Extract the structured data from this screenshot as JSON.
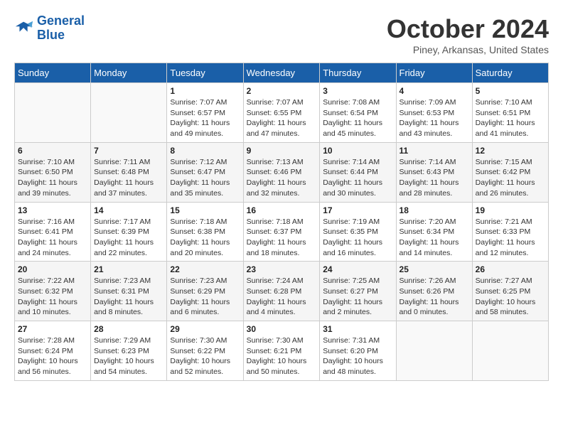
{
  "logo": {
    "line1": "General",
    "line2": "Blue"
  },
  "title": "October 2024",
  "location": "Piney, Arkansas, United States",
  "days_header": [
    "Sunday",
    "Monday",
    "Tuesday",
    "Wednesday",
    "Thursday",
    "Friday",
    "Saturday"
  ],
  "weeks": [
    [
      {
        "date": "",
        "sunrise": "",
        "sunset": "",
        "daylight": ""
      },
      {
        "date": "",
        "sunrise": "",
        "sunset": "",
        "daylight": ""
      },
      {
        "date": "1",
        "sunrise": "Sunrise: 7:07 AM",
        "sunset": "Sunset: 6:57 PM",
        "daylight": "Daylight: 11 hours and 49 minutes."
      },
      {
        "date": "2",
        "sunrise": "Sunrise: 7:07 AM",
        "sunset": "Sunset: 6:55 PM",
        "daylight": "Daylight: 11 hours and 47 minutes."
      },
      {
        "date": "3",
        "sunrise": "Sunrise: 7:08 AM",
        "sunset": "Sunset: 6:54 PM",
        "daylight": "Daylight: 11 hours and 45 minutes."
      },
      {
        "date": "4",
        "sunrise": "Sunrise: 7:09 AM",
        "sunset": "Sunset: 6:53 PM",
        "daylight": "Daylight: 11 hours and 43 minutes."
      },
      {
        "date": "5",
        "sunrise": "Sunrise: 7:10 AM",
        "sunset": "Sunset: 6:51 PM",
        "daylight": "Daylight: 11 hours and 41 minutes."
      }
    ],
    [
      {
        "date": "6",
        "sunrise": "Sunrise: 7:10 AM",
        "sunset": "Sunset: 6:50 PM",
        "daylight": "Daylight: 11 hours and 39 minutes."
      },
      {
        "date": "7",
        "sunrise": "Sunrise: 7:11 AM",
        "sunset": "Sunset: 6:48 PM",
        "daylight": "Daylight: 11 hours and 37 minutes."
      },
      {
        "date": "8",
        "sunrise": "Sunrise: 7:12 AM",
        "sunset": "Sunset: 6:47 PM",
        "daylight": "Daylight: 11 hours and 35 minutes."
      },
      {
        "date": "9",
        "sunrise": "Sunrise: 7:13 AM",
        "sunset": "Sunset: 6:46 PM",
        "daylight": "Daylight: 11 hours and 32 minutes."
      },
      {
        "date": "10",
        "sunrise": "Sunrise: 7:14 AM",
        "sunset": "Sunset: 6:44 PM",
        "daylight": "Daylight: 11 hours and 30 minutes."
      },
      {
        "date": "11",
        "sunrise": "Sunrise: 7:14 AM",
        "sunset": "Sunset: 6:43 PM",
        "daylight": "Daylight: 11 hours and 28 minutes."
      },
      {
        "date": "12",
        "sunrise": "Sunrise: 7:15 AM",
        "sunset": "Sunset: 6:42 PM",
        "daylight": "Daylight: 11 hours and 26 minutes."
      }
    ],
    [
      {
        "date": "13",
        "sunrise": "Sunrise: 7:16 AM",
        "sunset": "Sunset: 6:41 PM",
        "daylight": "Daylight: 11 hours and 24 minutes."
      },
      {
        "date": "14",
        "sunrise": "Sunrise: 7:17 AM",
        "sunset": "Sunset: 6:39 PM",
        "daylight": "Daylight: 11 hours and 22 minutes."
      },
      {
        "date": "15",
        "sunrise": "Sunrise: 7:18 AM",
        "sunset": "Sunset: 6:38 PM",
        "daylight": "Daylight: 11 hours and 20 minutes."
      },
      {
        "date": "16",
        "sunrise": "Sunrise: 7:18 AM",
        "sunset": "Sunset: 6:37 PM",
        "daylight": "Daylight: 11 hours and 18 minutes."
      },
      {
        "date": "17",
        "sunrise": "Sunrise: 7:19 AM",
        "sunset": "Sunset: 6:35 PM",
        "daylight": "Daylight: 11 hours and 16 minutes."
      },
      {
        "date": "18",
        "sunrise": "Sunrise: 7:20 AM",
        "sunset": "Sunset: 6:34 PM",
        "daylight": "Daylight: 11 hours and 14 minutes."
      },
      {
        "date": "19",
        "sunrise": "Sunrise: 7:21 AM",
        "sunset": "Sunset: 6:33 PM",
        "daylight": "Daylight: 11 hours and 12 minutes."
      }
    ],
    [
      {
        "date": "20",
        "sunrise": "Sunrise: 7:22 AM",
        "sunset": "Sunset: 6:32 PM",
        "daylight": "Daylight: 11 hours and 10 minutes."
      },
      {
        "date": "21",
        "sunrise": "Sunrise: 7:23 AM",
        "sunset": "Sunset: 6:31 PM",
        "daylight": "Daylight: 11 hours and 8 minutes."
      },
      {
        "date": "22",
        "sunrise": "Sunrise: 7:23 AM",
        "sunset": "Sunset: 6:29 PM",
        "daylight": "Daylight: 11 hours and 6 minutes."
      },
      {
        "date": "23",
        "sunrise": "Sunrise: 7:24 AM",
        "sunset": "Sunset: 6:28 PM",
        "daylight": "Daylight: 11 hours and 4 minutes."
      },
      {
        "date": "24",
        "sunrise": "Sunrise: 7:25 AM",
        "sunset": "Sunset: 6:27 PM",
        "daylight": "Daylight: 11 hours and 2 minutes."
      },
      {
        "date": "25",
        "sunrise": "Sunrise: 7:26 AM",
        "sunset": "Sunset: 6:26 PM",
        "daylight": "Daylight: 11 hours and 0 minutes."
      },
      {
        "date": "26",
        "sunrise": "Sunrise: 7:27 AM",
        "sunset": "Sunset: 6:25 PM",
        "daylight": "Daylight: 10 hours and 58 minutes."
      }
    ],
    [
      {
        "date": "27",
        "sunrise": "Sunrise: 7:28 AM",
        "sunset": "Sunset: 6:24 PM",
        "daylight": "Daylight: 10 hours and 56 minutes."
      },
      {
        "date": "28",
        "sunrise": "Sunrise: 7:29 AM",
        "sunset": "Sunset: 6:23 PM",
        "daylight": "Daylight: 10 hours and 54 minutes."
      },
      {
        "date": "29",
        "sunrise": "Sunrise: 7:30 AM",
        "sunset": "Sunset: 6:22 PM",
        "daylight": "Daylight: 10 hours and 52 minutes."
      },
      {
        "date": "30",
        "sunrise": "Sunrise: 7:30 AM",
        "sunset": "Sunset: 6:21 PM",
        "daylight": "Daylight: 10 hours and 50 minutes."
      },
      {
        "date": "31",
        "sunrise": "Sunrise: 7:31 AM",
        "sunset": "Sunset: 6:20 PM",
        "daylight": "Daylight: 10 hours and 48 minutes."
      },
      {
        "date": "",
        "sunrise": "",
        "sunset": "",
        "daylight": ""
      },
      {
        "date": "",
        "sunrise": "",
        "sunset": "",
        "daylight": ""
      }
    ]
  ]
}
